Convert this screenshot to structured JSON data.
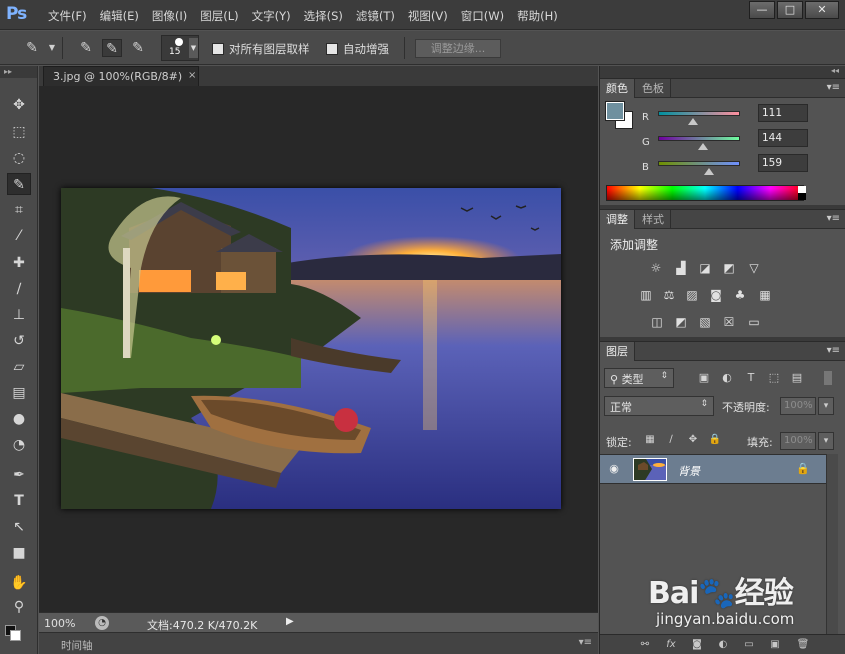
{
  "app": {
    "logo": "Ps"
  },
  "menu": [
    "文件(F)",
    "编辑(E)",
    "图像(I)",
    "图层(L)",
    "文字(Y)",
    "选择(S)",
    "滤镜(T)",
    "视图(V)",
    "窗口(W)",
    "帮助(H)"
  ],
  "window_controls": {
    "minimize": "—",
    "restore": "□",
    "close": "✕"
  },
  "options_bar": {
    "brush_size": "15",
    "sample_all_layers": {
      "label": "对所有图层取样",
      "checked": false
    },
    "auto_enhance": {
      "label": "自动增强",
      "checked": false
    },
    "refine_edge": "调整边缘..."
  },
  "document": {
    "tab_title": "3.jpg @ 100%(RGB/8#)",
    "tab_close": "×"
  },
  "status": {
    "zoom": "100%",
    "doc_size": "文档:470.2 K/470.2K",
    "timeline": "时间轴"
  },
  "color_panel": {
    "tabs": [
      "颜色",
      "色板"
    ],
    "foreground": "#6f909f",
    "background": "#ffffff",
    "r": {
      "label": "R",
      "value": "111"
    },
    "g": {
      "label": "G",
      "value": "144"
    },
    "b": {
      "label": "B",
      "value": "159"
    }
  },
  "adjustments_panel": {
    "tabs": [
      "调整",
      "样式"
    ],
    "title": "添加调整"
  },
  "layers_panel": {
    "tab": "图层",
    "filter_type": "类型",
    "blend_mode": "正常",
    "opacity_label": "不透明度:",
    "opacity_value": "100%",
    "lock_label": "锁定:",
    "fill_label": "填充:",
    "fill_value": "100%",
    "layers": [
      {
        "name": "背景",
        "visible": true,
        "locked": true
      }
    ],
    "bottom_icons": [
      "link-icon",
      "fx-icon",
      "mask-icon",
      "adjustment-icon",
      "folder-icon",
      "new-layer-icon",
      "trash-icon"
    ],
    "bottom_labels": [
      "⚯",
      "fx",
      "◙",
      "◐",
      "▭",
      "▣",
      "🗑"
    ]
  },
  "watermark": {
    "brand": "Bai🐾经验",
    "url": "jingyan.baidu.com"
  }
}
